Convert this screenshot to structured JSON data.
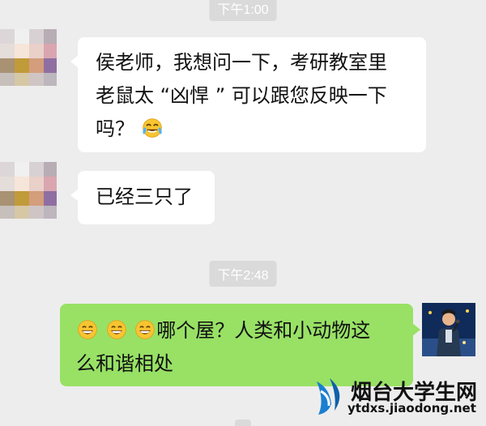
{
  "timestamps": [
    "下午1:00",
    "下午2:48"
  ],
  "messages": {
    "m1": {
      "line1": "侯老师，我想问一下，考研教室里",
      "line2": "老鼠太 “凶悍 ” 可以跟您反映一下",
      "line3": "吗？"
    },
    "m2": {
      "text": "已经三只了"
    },
    "m3": {
      "line1": "哪个屋？人类和小动物这",
      "line2": "么和谐相处"
    }
  },
  "watermark": {
    "name": "烟台大学生网",
    "url": "ytdxs.jiaodong.net"
  },
  "colors": {
    "background": "#ededed",
    "timestamp_pill": "#dadada",
    "incoming_bubble": "#ffffff",
    "outgoing_bubble": "#98e165",
    "emoji_yellow": "#f7c531"
  },
  "icons": {
    "incoming_emoji": "tears-of-joy-emoji",
    "outgoing_emoji": "grinning-face-emoji",
    "watermark_logo": "wave-logo-icon"
  }
}
